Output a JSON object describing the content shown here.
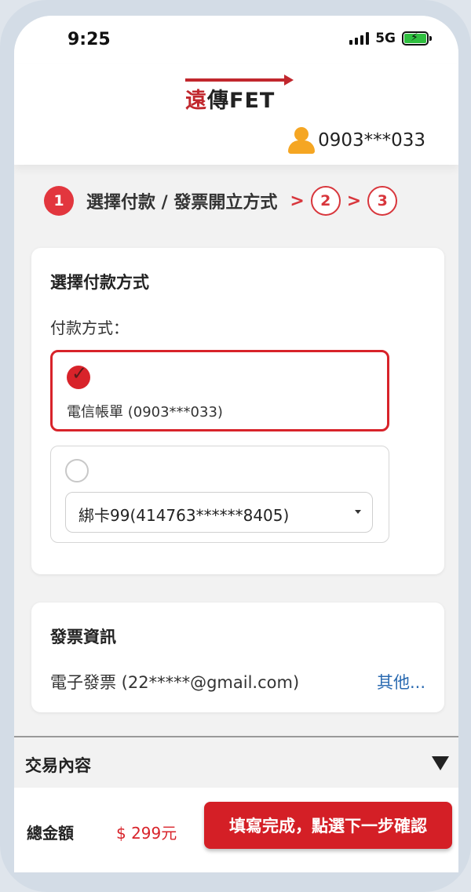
{
  "status_bar": {
    "time": "9:25",
    "network": "5G",
    "icons": [
      "signal-icon",
      "battery-charging-icon"
    ]
  },
  "header": {
    "logo_text_red": "遠",
    "logo_text_rest": "傳FET",
    "user_phone": "0903***033",
    "icons": [
      "user-icon"
    ]
  },
  "stepper": {
    "steps": [
      {
        "number": "1",
        "label": "選擇付款 / 發票開立方式",
        "active": true
      },
      {
        "number": "2"
      },
      {
        "number": "3"
      }
    ]
  },
  "payment": {
    "title": "選擇付款方式",
    "method_label": "付款方式：",
    "options": [
      {
        "label": "電信帳單 (0903***033)",
        "selected": true
      },
      {
        "select_value": "綁卡99(414763******8405)",
        "selected": false
      }
    ]
  },
  "invoice": {
    "title": "發票資訊",
    "value": "電子發票 (22*****@gmail.com)",
    "other_link": "其他..."
  },
  "transaction": {
    "label": "交易內容"
  },
  "footer": {
    "total_label": "總金額",
    "total_amount": "$ 299元",
    "next_button": "填寫完成，點選下一步確認"
  },
  "colors": {
    "brand_red": "#d41f26",
    "user_icon": "#f5a623",
    "link_blue": "#2a6ab1"
  }
}
